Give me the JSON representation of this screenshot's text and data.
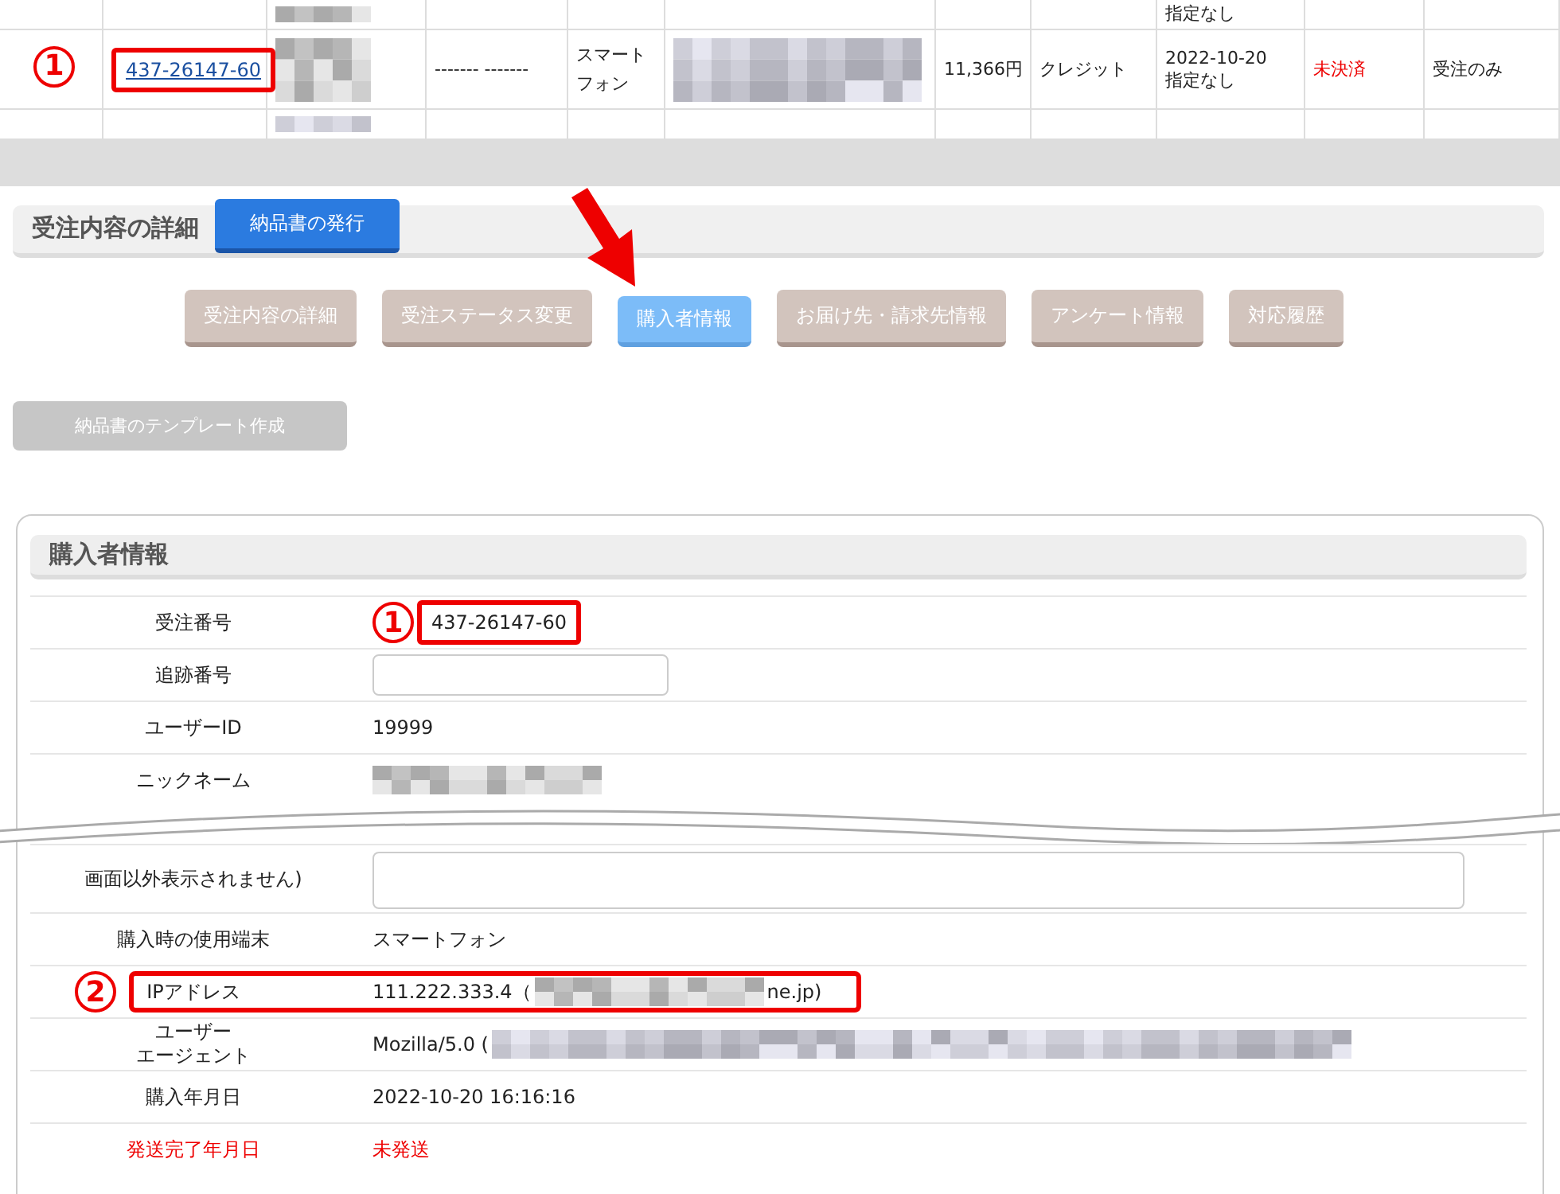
{
  "order_table": {
    "row_above": {
      "date_note": "指定なし"
    },
    "row": {
      "marker": "1",
      "order_no": "437-26147-60",
      "shipping": "------- -------",
      "device": "スマートフォン",
      "amount": "11,366円",
      "payment": "クレジット",
      "date": "2022-10-20",
      "date_note": "指定なし",
      "payment_status": "未決済",
      "status": "受注のみ"
    }
  },
  "section": {
    "title": "受注内容の詳細",
    "issue_button": "納品書の発行"
  },
  "tabs": [
    {
      "label": "受注内容の詳細",
      "selected": false
    },
    {
      "label": "受注ステータス変更",
      "selected": false
    },
    {
      "label": "購入者情報",
      "selected": true
    },
    {
      "label": "お届け先・請求先情報",
      "selected": false
    },
    {
      "label": "アンケート情報",
      "selected": false
    },
    {
      "label": "対応履歴",
      "selected": false
    }
  ],
  "template_button": "納品書のテンプレート作成",
  "buyer_info": {
    "title": "購入者情報",
    "rows": [
      {
        "kind": "text",
        "label": "受注番号",
        "marker": "1",
        "boxed_value": true,
        "parts": [
          {
            "kind": "text",
            "text": "437-26147-60"
          }
        ]
      },
      {
        "kind": "input",
        "label": "追跡番号"
      },
      {
        "kind": "text",
        "label": "ユーザーID",
        "parts": [
          {
            "kind": "text",
            "text": "19999"
          }
        ]
      },
      {
        "kind": "text",
        "label": "ニックネーム",
        "parts": [
          {
            "kind": "mosaic"
          }
        ]
      },
      {
        "kind": "cut"
      },
      {
        "kind": "textarea",
        "label": "画面以外表示されません)"
      },
      {
        "kind": "text",
        "label": "購入時の使用端末",
        "parts": [
          {
            "kind": "text",
            "text": "スマートフォン"
          }
        ]
      },
      {
        "kind": "text",
        "label": "IPアドレス",
        "marker": "2",
        "boxed_row": true,
        "parts": [
          {
            "kind": "text",
            "text": "111.222.333.4（"
          },
          {
            "kind": "mosaic"
          },
          {
            "kind": "text",
            "text": "ne.jp)"
          }
        ]
      },
      {
        "kind": "text",
        "label": [
          "ユーザー",
          "エージェント"
        ],
        "parts": [
          {
            "kind": "text",
            "text": "Mozilla/5.0 ("
          },
          {
            "kind": "mosaic",
            "wide": true
          }
        ]
      },
      {
        "kind": "text",
        "label": "購入年月日",
        "parts": [
          {
            "kind": "text",
            "text": "2022-10-20 16:16:16"
          }
        ]
      },
      {
        "kind": "text",
        "label": "発送完了年月日",
        "alert": true,
        "parts": [
          {
            "kind": "text",
            "text": "未発送"
          }
        ]
      }
    ]
  }
}
